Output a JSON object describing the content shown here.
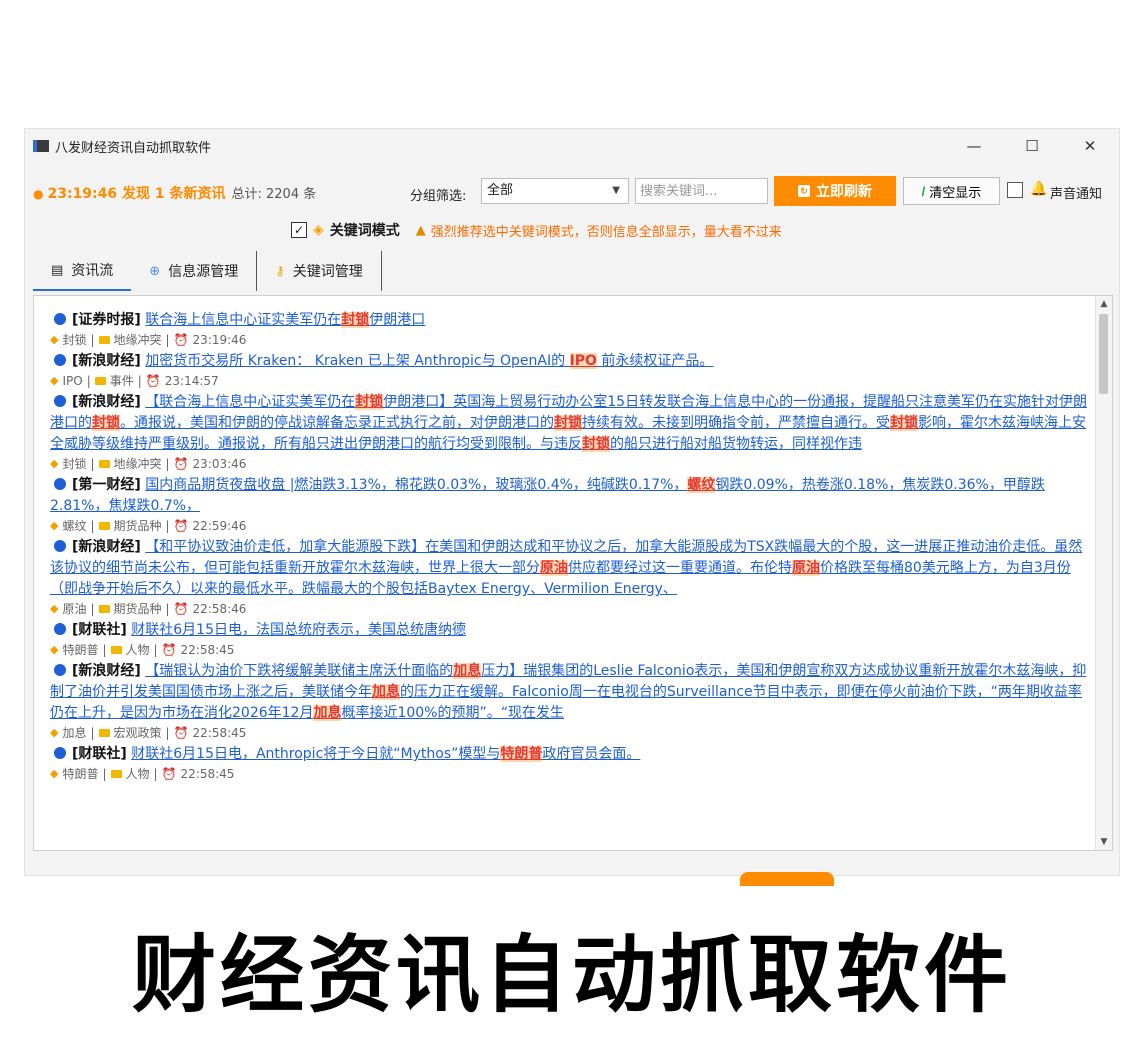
{
  "window": {
    "title": "八发财经资讯自动抓取软件",
    "controls": {
      "minimize": "—",
      "maximize": "☐",
      "close": "✕"
    }
  },
  "toolbar": {
    "status_text": "23:19:46 发现 1 条新资讯",
    "total_text": "总计: 2204 条",
    "group_label": "分组筛选:",
    "group_value": "全部",
    "search_placeholder": "搜索关键词...",
    "refresh_label": "立即刷新",
    "clear_label": "清空显示",
    "sound_label": "声音通知"
  },
  "keyword_mode": {
    "checked": "✓",
    "label": "关键词模式",
    "warning": "强烈推荐选中关键词模式，否则信息全部显示，量大看不过来"
  },
  "tabs": [
    {
      "label": "资讯流"
    },
    {
      "label": "信息源管理"
    },
    {
      "label": "关键词管理"
    }
  ],
  "feed": [
    {
      "source": "[证券时报]",
      "parts": [
        "联合海上信息中心证实美军仍在",
        "封锁",
        "伊朗港口"
      ],
      "keyword": "封锁",
      "category": "地缘冲突",
      "time": "23:19:46"
    },
    {
      "source": "[新浪财经]",
      "parts": [
        "加密货币交易所 Kraken： Kraken 已上架 Anthropic与 OpenAI的 ",
        "IPO",
        " 前永续权证产品。"
      ],
      "keyword": "IPO",
      "category": "事件",
      "time": "23:14:57"
    },
    {
      "source": "[新浪财经]",
      "parts": [
        "【联合海上信息中心证实美军仍在",
        "封锁",
        "伊朗港口】英国海上贸易行动办公室15日转发联合海上信息中心的一份通报，提醒船只注意美军仍在实施针对伊朗港口的",
        "封锁",
        "。通报说，美国和伊朗的停战谅解备忘录正式执行之前，对伊朗港口的",
        "封锁",
        "持续有效。未接到明确指令前，严禁擅自通行。受",
        "封锁",
        "影响，霍尔木兹海峡海上安全威胁等级维持严重级别。通报说，所有船只进出伊朗港口的航行均受到限制。与违反",
        "封锁",
        "的船只进行船对船货物转运，同样视作违"
      ],
      "keyword": "封锁",
      "category": "地缘冲突",
      "time": "23:03:46"
    },
    {
      "source": "[第一财经]",
      "parts": [
        "国内商品期货夜盘收盘 |燃油跌3.13%，棉花跌0.03%，玻璃涨0.4%，纯碱跌0.17%，",
        "螺纹",
        "钢跌0.09%，热卷涨0.18%，焦炭跌0.36%，甲醇跌2.81%，焦煤跌0.7%，"
      ],
      "keyword": "螺纹",
      "category": "期货品种",
      "time": "22:59:46"
    },
    {
      "source": "[新浪财经]",
      "parts": [
        "【和平协议致油价走低，加拿大能源股下跌】在美国和伊朗达成和平协议之后，加拿大能源股成为TSX跌幅最大的个股，这一进展正推动油价走低。虽然该协议的细节尚未公布，但可能包括重新开放霍尔木兹海峡，世界上很大一部分",
        "原油",
        "供应都要经过这一重要通道。布伦特",
        "原油",
        "价格跌至每桶80美元略上方，为自3月份（即战争开始后不久）以来的最低水平。跌幅最大的个股包括Baytex Energy、Vermilion Energy、"
      ],
      "keyword": "原油",
      "category": "期货品种",
      "time": "22:58:46"
    },
    {
      "source": "[财联社]",
      "parts": [
        "财联社6月15日电，法国总统府表示，美国总统唐纳德"
      ],
      "keyword": "特朗普",
      "category": "人物",
      "time": "22:58:45"
    },
    {
      "source": "[新浪财经]",
      "parts": [
        "【瑞银认为油价下跌将缓解美联储主席沃什面临的",
        "加息",
        "压力】瑞银集团的Leslie Falconio表示，美国和伊朗宣称双方达成协议重新开放霍尔木兹海峡，抑制了油价并引发美国国债市场上涨之后，美联储今年",
        "加息",
        "的压力正在缓解。Falconio周一在电视台的Surveillance节目中表示，即便在停火前油价下跌，“两年期收益率仍在上升，是因为市场在消化2026年12月",
        "加息",
        "概率接近100%的预期”。“现在发生"
      ],
      "keyword": "加息",
      "category": "宏观政策",
      "time": "22:58:45"
    },
    {
      "source": "[财联社]",
      "parts": [
        "财联社6月15日电，Anthropic将于今日就“Mythos”模型与",
        "特朗普",
        "政府官员会面。"
      ],
      "keyword": "特朗普",
      "category": "人物",
      "time": "22:58:45"
    }
  ],
  "banner": "财经资讯自动抓取软件",
  "colors": {
    "accent": "#ff8c00",
    "link": "#1e5fd6",
    "highlight": "#e53935",
    "highlight_bg": "#ffd9b3"
  }
}
